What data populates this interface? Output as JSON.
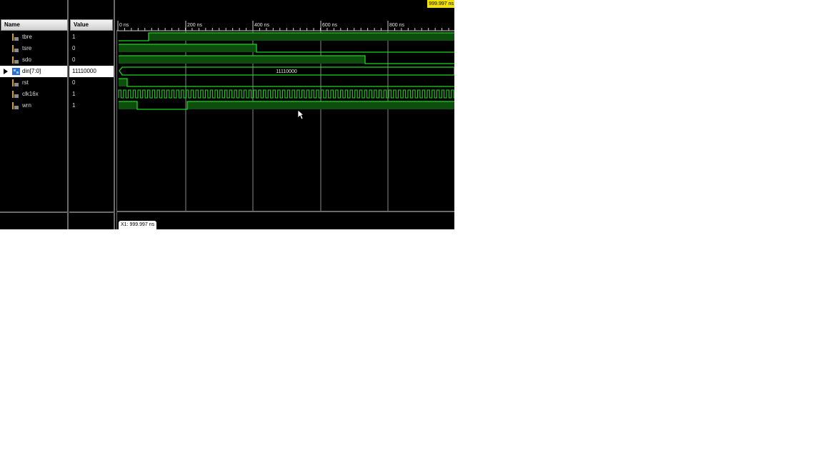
{
  "columns": {
    "name": "Name",
    "value": "Value"
  },
  "ruler": {
    "ticks": [
      "0 ns",
      "200 ns",
      "400 ns",
      "600 ns",
      "800 ns"
    ]
  },
  "time_badge": "999.997 ns",
  "cursor_readout": "X1: 999.997 ns",
  "signals": [
    {
      "name": "tbre",
      "value": "1"
    },
    {
      "name": "tsre",
      "value": "0"
    },
    {
      "name": "sdo",
      "value": "0"
    },
    {
      "name": "din[7:0]",
      "value": "11110000",
      "bus_label": "11110000"
    },
    {
      "name": "rst",
      "value": "0"
    },
    {
      "name": "clk16x",
      "value": "1"
    },
    {
      "name": "wrn",
      "value": "1"
    }
  ],
  "colors": {
    "wave": "#1ed41e",
    "fill": "#0d4d0d",
    "grid": "#8a8a8a",
    "badge": "#f2e200"
  }
}
